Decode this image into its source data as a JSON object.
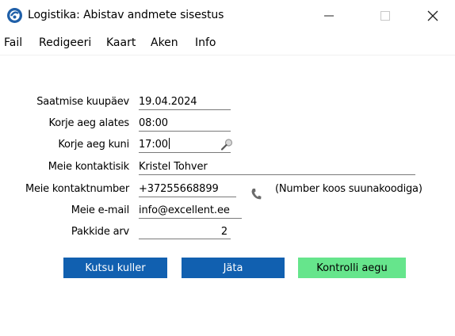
{
  "window": {
    "title": "Logistika: Abistav andmete sisestus",
    "minimize_icon": "minimize-icon",
    "maximize_icon": "maximize-icon",
    "close_icon": "close-icon"
  },
  "menu": [
    "Fail",
    "Redigeeri",
    "Kaart",
    "Aken",
    "Info"
  ],
  "form": {
    "pickup_date": {
      "label": "Saatmise kuupäev",
      "value": "19.04.2024"
    },
    "pickup_from": {
      "label": "Korje aeg alates",
      "value": "08:00"
    },
    "pickup_until": {
      "label": "Korje aeg kuni",
      "value": "17:00"
    },
    "contact": {
      "label": "Meie kontaktisik",
      "value": "Kristel Tohver"
    },
    "phone": {
      "label": "Meie kontaktnumber",
      "value": "+37255668899",
      "hint": "(Number koos suunakoodiga)"
    },
    "email": {
      "label": "Meie e-mail",
      "value": "info@excellent.ee"
    },
    "packages": {
      "label": "Pakkide arv",
      "value": "2"
    }
  },
  "buttons": {
    "call_courier": "Kutsu kuller",
    "skip": "Jäta",
    "check_times": "Kontrolli aegu"
  },
  "colors": {
    "primary_button": "#1160b0",
    "success_button": "#66e58c"
  }
}
